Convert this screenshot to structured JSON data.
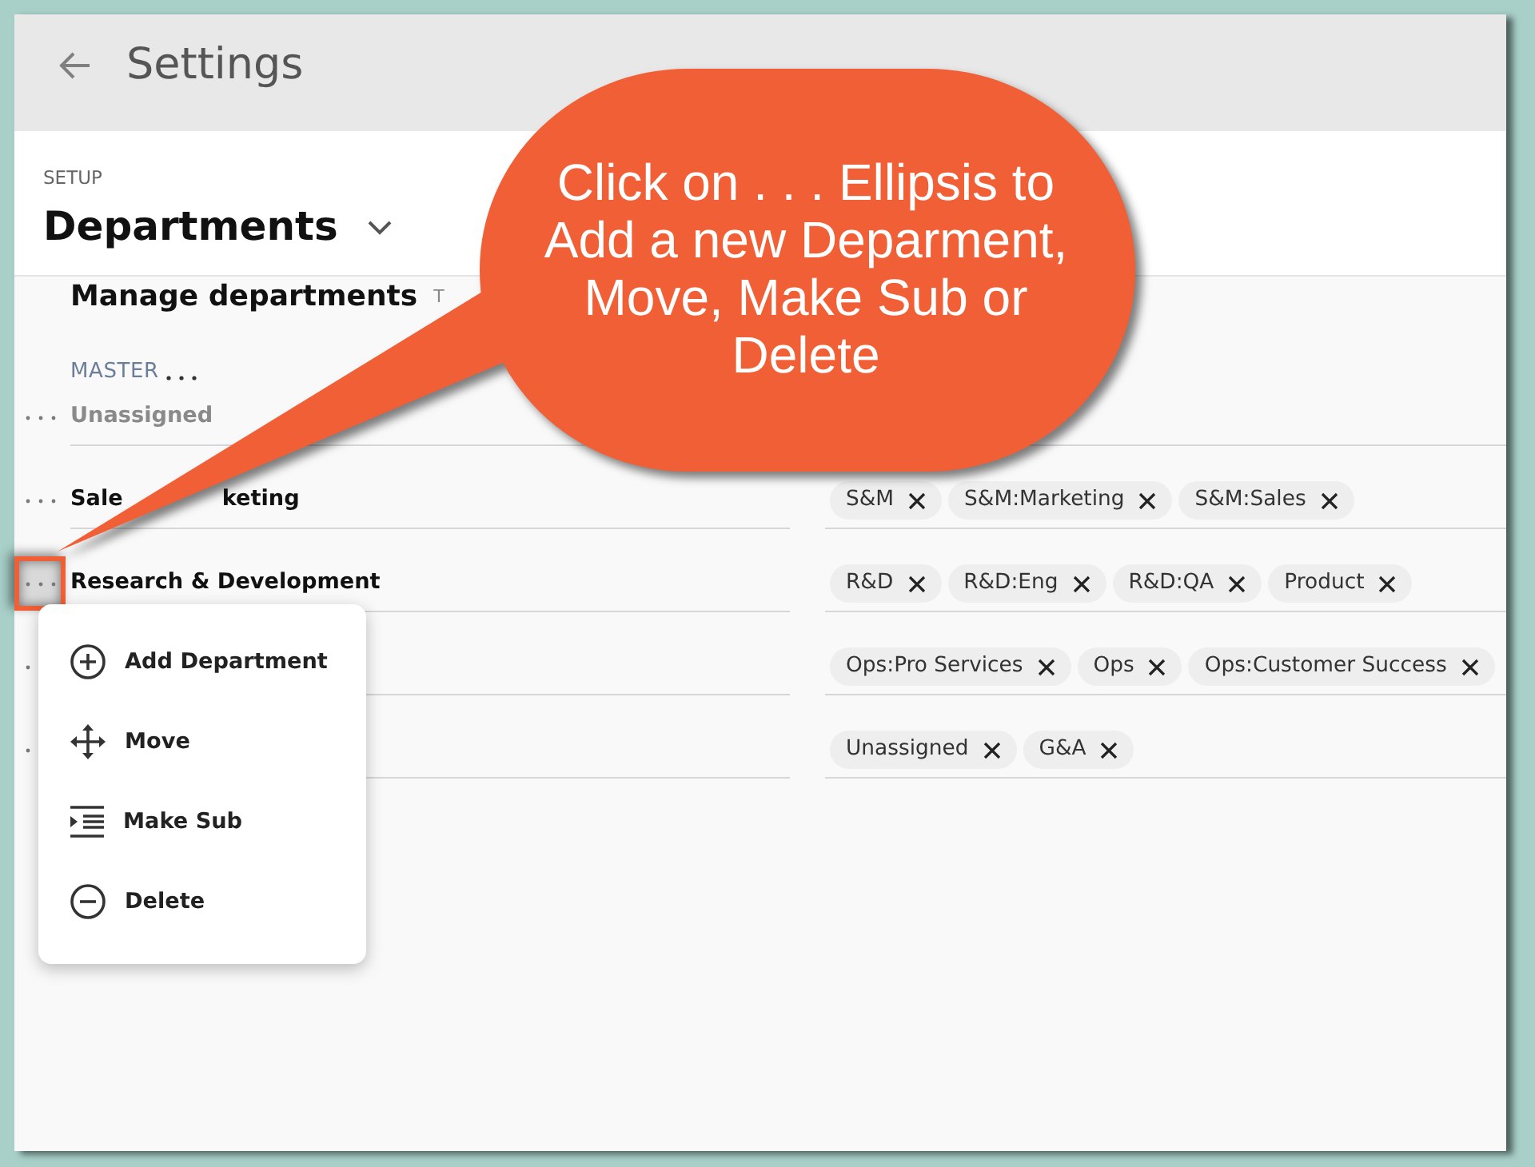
{
  "header": {
    "title": "Settings"
  },
  "setup": {
    "eyebrow": "SETUP",
    "title": "Departments"
  },
  "manage": {
    "title": "Manage departments",
    "hint": "T"
  },
  "master": {
    "label": "MASTER"
  },
  "rows": [
    {
      "name": "Unassigned",
      "disabled": true,
      "highlighted": false,
      "menu_open": false
    },
    {
      "name_parts": [
        "Sale",
        "keting"
      ],
      "disabled": false,
      "highlighted": false,
      "menu_open": false,
      "tags": [
        "S&M",
        "S&M:Marketing",
        "S&M:Sales"
      ]
    },
    {
      "name": "Research & Development",
      "disabled": false,
      "highlighted": true,
      "menu_open": true,
      "tags": [
        "R&D",
        "R&D:Eng",
        "R&D:QA",
        "Product"
      ]
    },
    {
      "highlighted": false,
      "menu_open": false,
      "tags": [
        "Ops:Pro Services",
        "Ops",
        "Ops:Customer Success"
      ]
    },
    {
      "highlighted": false,
      "menu_open": false,
      "tags": [
        "Unassigned",
        "G&A"
      ]
    }
  ],
  "row_menu": {
    "items": [
      {
        "kind": "add",
        "label": "Add Department"
      },
      {
        "kind": "move",
        "label": "Move"
      },
      {
        "kind": "indent",
        "label": "Make Sub"
      },
      {
        "kind": "remove",
        "label": "Delete"
      }
    ]
  },
  "callout": {
    "text": "Click on . . . Ellipsis to Add a new Deparment, Move, Make Sub or Delete"
  }
}
